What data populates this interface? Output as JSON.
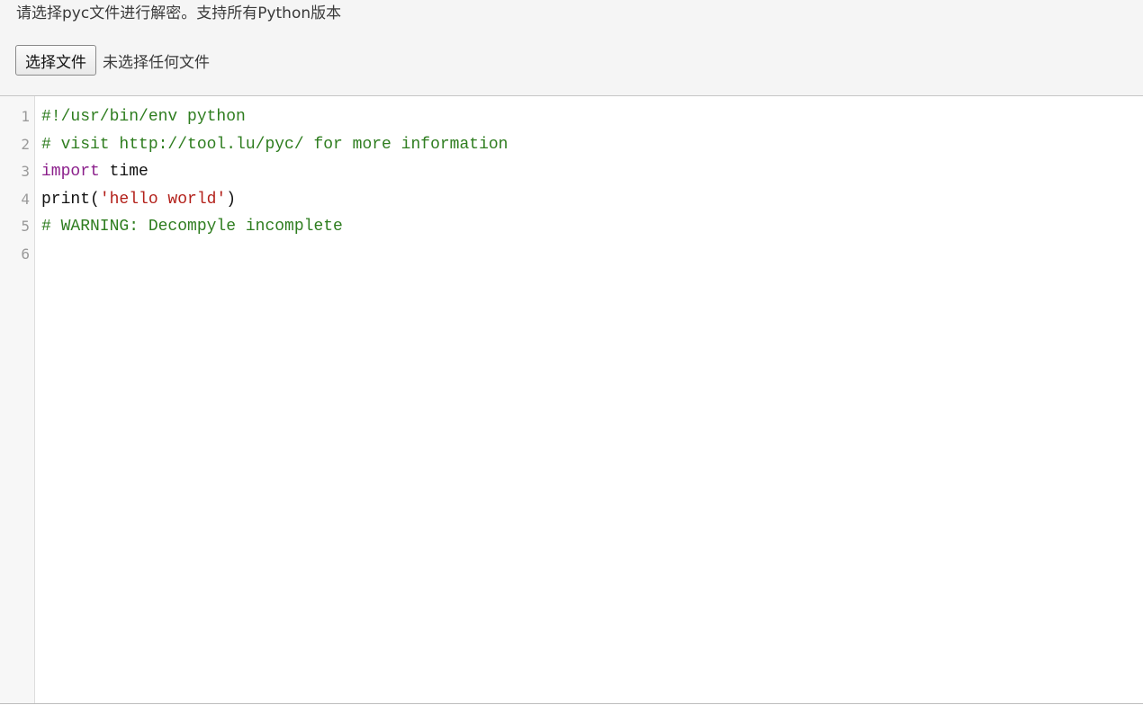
{
  "header": {
    "instruction": "请选择pyc文件进行解密。支持所有Python版本",
    "file_button_label": "选择文件",
    "file_status": "未选择任何文件"
  },
  "editor": {
    "line_numbers": [
      "1",
      "2",
      "3",
      "4",
      "5",
      "6"
    ],
    "lines": [
      {
        "tokens": [
          {
            "text": "#!/usr/bin/env python",
            "type": "comment"
          }
        ]
      },
      {
        "tokens": [
          {
            "text": "# visit http://tool.lu/pyc/ for more information",
            "type": "comment"
          }
        ]
      },
      {
        "tokens": [
          {
            "text": "import",
            "type": "keyword"
          },
          {
            "text": " time",
            "type": "plain"
          }
        ]
      },
      {
        "tokens": [
          {
            "text": "print(",
            "type": "plain"
          },
          {
            "text": "'hello world'",
            "type": "string"
          },
          {
            "text": ")",
            "type": "plain"
          }
        ]
      },
      {
        "tokens": [
          {
            "text": "# WARNING: Decompyle incomplete",
            "type": "comment"
          }
        ]
      },
      {
        "tokens": []
      }
    ]
  },
  "colors": {
    "comment": "#2e7d1f",
    "keyword": "#8b1f8b",
    "string": "#b3201a",
    "plain": "#111111",
    "panel_background": "#f5f5f5"
  }
}
